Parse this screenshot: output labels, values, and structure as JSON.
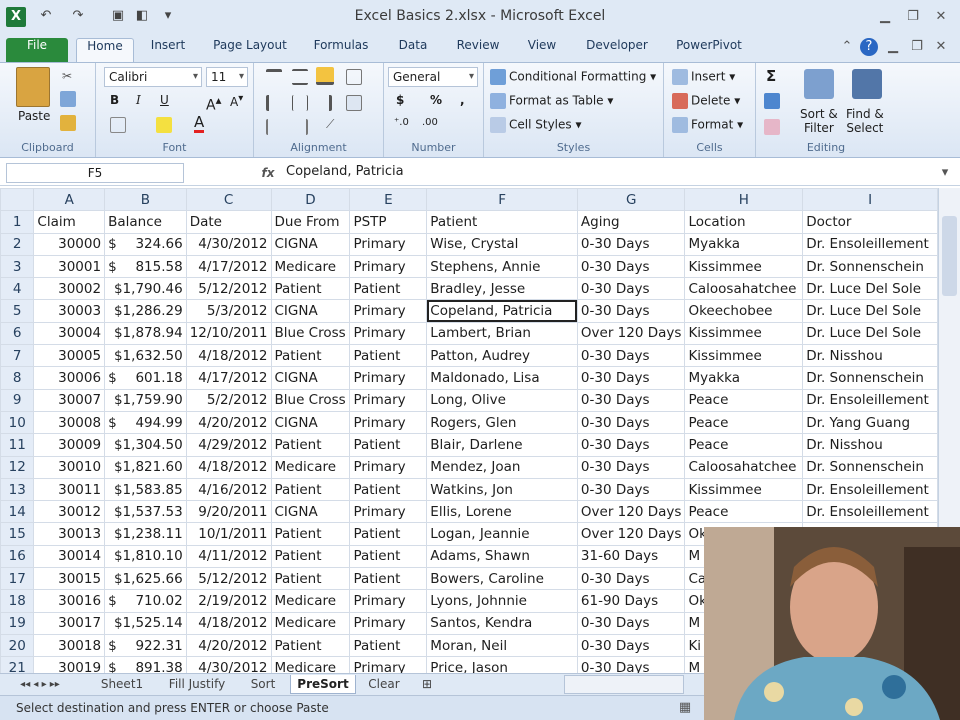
{
  "window": {
    "title": "Excel Basics 2.xlsx - Microsoft Excel",
    "app_icon_letter": "X"
  },
  "tabs": [
    "File",
    "Home",
    "Insert",
    "Page Layout",
    "Formulas",
    "Data",
    "Review",
    "View",
    "Developer",
    "PowerPivot"
  ],
  "ribbon": {
    "clipboard": {
      "label": "Clipboard",
      "paste": "Paste"
    },
    "font": {
      "label": "Font",
      "name": "Calibri",
      "size": "11",
      "bold": "B",
      "italic": "I",
      "underline": "U"
    },
    "alignment": {
      "label": "Alignment"
    },
    "number": {
      "label": "Number",
      "format": "General",
      "currency": "$",
      "percent": "%",
      "comma": ","
    },
    "styles": {
      "label": "Styles",
      "conditional": "Conditional Formatting",
      "table": "Format as Table",
      "cell_styles": "Cell Styles"
    },
    "cells": {
      "label": "Cells",
      "insert": "Insert",
      "delete": "Delete",
      "format": "Format"
    },
    "editing": {
      "label": "Editing",
      "sigma": "Σ",
      "sort_filter_1": "Sort &",
      "sort_filter_2": "Filter",
      "find_select_1": "Find &",
      "find_select_2": "Select"
    }
  },
  "formula_bar": {
    "name_box": "F5",
    "fx": "fx",
    "value": "Copeland, Patricia"
  },
  "columns": [
    "A",
    "B",
    "C",
    "D",
    "E",
    "F",
    "G",
    "H",
    "I"
  ],
  "header_row": [
    "Claim",
    "Balance",
    "Date",
    "Due From",
    "PSTP",
    "Patient",
    "Aging",
    "Location",
    "Doctor"
  ],
  "rows": [
    [
      "30000",
      "324.66",
      "4/30/2012",
      "CIGNA",
      "Primary",
      "Wise, Crystal",
      "0-30 Days",
      "Myakka",
      "Dr. Ensoleillement"
    ],
    [
      "30001",
      "815.58",
      "4/17/2012",
      "Medicare",
      "Primary",
      "Stephens, Annie",
      "0-30 Days",
      "Kissimmee",
      "Dr. Sonnenschein"
    ],
    [
      "30002",
      "$1,790.46",
      "5/12/2012",
      "Patient",
      "Patient",
      "Bradley, Jesse",
      "0-30 Days",
      "Caloosahatchee",
      "Dr. Luce Del Sole"
    ],
    [
      "30003",
      "$1,286.29",
      "5/3/2012",
      "CIGNA",
      "Primary",
      "Copeland, Patricia",
      "0-30 Days",
      "Okeechobee",
      "Dr. Luce Del Sole"
    ],
    [
      "30004",
      "$1,878.94",
      "12/10/2011",
      "Blue Cross",
      "Primary",
      "Lambert, Brian",
      "Over 120 Days",
      "Kissimmee",
      "Dr. Luce Del Sole"
    ],
    [
      "30005",
      "$1,632.50",
      "4/18/2012",
      "Patient",
      "Patient",
      "Patton, Audrey",
      "0-30 Days",
      "Kissimmee",
      "Dr. Nisshou"
    ],
    [
      "30006",
      "601.18",
      "4/17/2012",
      "CIGNA",
      "Primary",
      "Maldonado, Lisa",
      "0-30 Days",
      "Myakka",
      "Dr. Sonnenschein"
    ],
    [
      "30007",
      "$1,759.90",
      "5/2/2012",
      "Blue Cross",
      "Primary",
      "Long, Olive",
      "0-30 Days",
      "Peace",
      "Dr. Ensoleillement"
    ],
    [
      "30008",
      "494.99",
      "4/20/2012",
      "CIGNA",
      "Primary",
      "Rogers, Glen",
      "0-30 Days",
      "Peace",
      "Dr. Yang Guang"
    ],
    [
      "30009",
      "$1,304.50",
      "4/29/2012",
      "Patient",
      "Patient",
      "Blair, Darlene",
      "0-30 Days",
      "Peace",
      "Dr. Nisshou"
    ],
    [
      "30010",
      "$1,821.60",
      "4/18/2012",
      "Medicare",
      "Primary",
      "Mendez, Joan",
      "0-30 Days",
      "Caloosahatchee",
      "Dr. Sonnenschein"
    ],
    [
      "30011",
      "$1,583.85",
      "4/16/2012",
      "Patient",
      "Patient",
      "Watkins, Jon",
      "0-30 Days",
      "Kissimmee",
      "Dr. Ensoleillement"
    ],
    [
      "30012",
      "$1,537.53",
      "9/20/2011",
      "CIGNA",
      "Primary",
      "Ellis, Lorene",
      "Over 120 Days",
      "Peace",
      "Dr. Ensoleillement"
    ],
    [
      "30013",
      "$1,238.11",
      "10/1/2011",
      "Patient",
      "Patient",
      "Logan, Jeannie",
      "Over 120 Days",
      "Ok",
      ""
    ],
    [
      "30014",
      "$1,810.10",
      "4/11/2012",
      "Patient",
      "Patient",
      "Adams, Shawn",
      "31-60 Days",
      "M",
      ""
    ],
    [
      "30015",
      "$1,625.66",
      "5/12/2012",
      "Patient",
      "Patient",
      "Bowers, Caroline",
      "0-30 Days",
      "Ca",
      ""
    ],
    [
      "30016",
      "710.02",
      "2/19/2012",
      "Medicare",
      "Primary",
      "Lyons, Johnnie",
      "61-90 Days",
      "Ok",
      ""
    ],
    [
      "30017",
      "$1,525.14",
      "4/18/2012",
      "Medicare",
      "Primary",
      "Santos, Kendra",
      "0-30 Days",
      "M",
      ""
    ],
    [
      "30018",
      "922.31",
      "4/20/2012",
      "Patient",
      "Patient",
      "Moran, Neil",
      "0-30 Days",
      "Ki",
      ""
    ],
    [
      "30019",
      "891.38",
      "4/30/2012",
      "Medicare",
      "Primary",
      "Price, Jason",
      "0-30 Days",
      "M",
      ""
    ]
  ],
  "sheet_tabs": [
    "Sheet1",
    "Fill Justify",
    "Sort",
    "PreSort",
    "Clear"
  ],
  "active_sheet": "PreSort",
  "status": "Select destination and press ENTER or choose Paste"
}
